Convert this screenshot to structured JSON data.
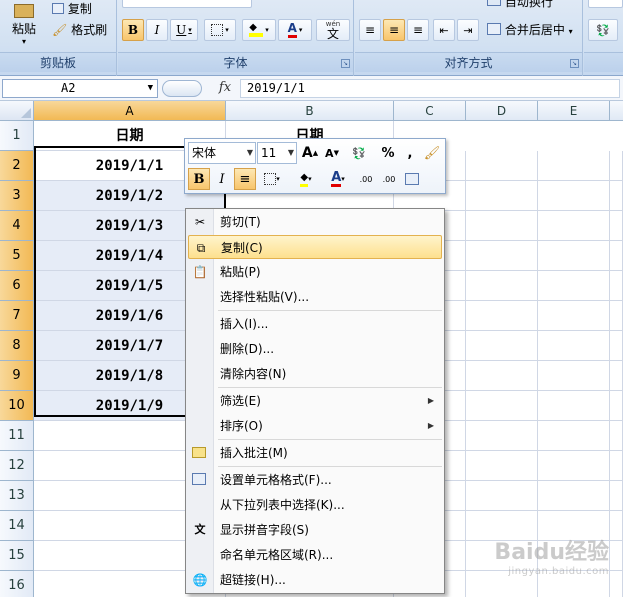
{
  "ribbon": {
    "clipboard": {
      "paste": "粘贴",
      "copy": "复制",
      "format_painter": "格式刷",
      "group_label": "剪贴板"
    },
    "font": {
      "group_label": "字体",
      "bold": "B",
      "italic": "I",
      "underline": "U",
      "font_color_glyph": "A",
      "wen": "wén",
      "wen_char": "文"
    },
    "alignment": {
      "group_label": "对齐方式",
      "merge_center": "合并后居中",
      "wrap": "自动换行"
    }
  },
  "formula_bar": {
    "name_box": "A2",
    "fx": "fx",
    "value": "2019/1/1"
  },
  "columns": [
    "A",
    "B",
    "C",
    "D",
    "E"
  ],
  "rows": [
    "1",
    "2",
    "3",
    "4",
    "5",
    "6",
    "7",
    "8",
    "9",
    "10",
    "11",
    "12",
    "13",
    "14",
    "15",
    "16"
  ],
  "cells": {
    "a1": "日期",
    "b1": "日期",
    "a_values": [
      "2019/1/1",
      "2019/1/2",
      "2019/1/3",
      "2019/1/4",
      "2019/1/5",
      "2019/1/6",
      "2019/1/7",
      "2019/1/8",
      "2019/1/9"
    ]
  },
  "mini_toolbar": {
    "font_name": "宋体",
    "font_size": "11",
    "grow": "A",
    "shrink": "A",
    "percent": "%",
    "comma": ",",
    "bold": "B",
    "italic": "I",
    "font_color": "A",
    "inc_decimal": ".00",
    "dec_decimal": ".00"
  },
  "context_menu": {
    "items": [
      {
        "label": "剪切(T)",
        "icon": "cut-icon"
      },
      {
        "label": "复制(C)",
        "icon": "copy-icon"
      },
      {
        "label": "粘贴(P)",
        "icon": "paste-icon"
      },
      {
        "label": "选择性粘贴(V)...",
        "icon": ""
      },
      {
        "label": "插入(I)...",
        "icon": ""
      },
      {
        "label": "删除(D)...",
        "icon": ""
      },
      {
        "label": "清除内容(N)",
        "icon": ""
      },
      {
        "label": "筛选(E)",
        "icon": ""
      },
      {
        "label": "排序(O)",
        "icon": ""
      },
      {
        "label": "插入批注(M)",
        "icon": "comment-icon"
      },
      {
        "label": "设置单元格格式(F)...",
        "icon": "format-cells-icon"
      },
      {
        "label": "从下拉列表中选择(K)...",
        "icon": ""
      },
      {
        "label": "显示拼音字段(S)",
        "icon": "phonetic-icon"
      },
      {
        "label": "命名单元格区域(R)...",
        "icon": ""
      },
      {
        "label": "超链接(H)...",
        "icon": "hyperlink-icon"
      }
    ]
  },
  "watermark": {
    "brand": "Baidu经验",
    "url": "jingyan.baidu.com"
  },
  "colors": {
    "selection_header": "#f2b954",
    "menu_highlight": "#fde08e",
    "ribbon": "#d2e1f2"
  }
}
